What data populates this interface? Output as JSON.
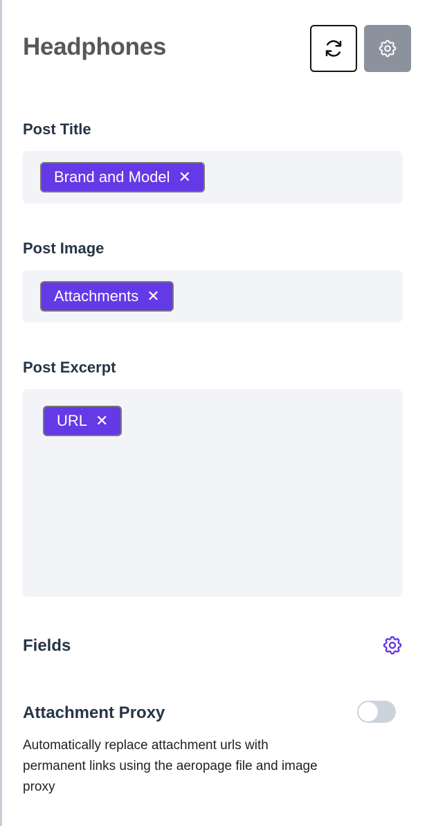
{
  "header": {
    "title": "Headphones",
    "refresh_icon": "refresh-icon",
    "settings_icon": "gear-icon"
  },
  "sections": [
    {
      "label": "Post Title",
      "chips": [
        "Brand and Model"
      ]
    },
    {
      "label": "Post Image",
      "chips": [
        "Attachments"
      ]
    },
    {
      "label": "Post Excerpt",
      "chips": [
        "URL"
      ]
    }
  ],
  "chip_remove": "✕",
  "fields": {
    "label": "Fields",
    "icon": "gear-icon"
  },
  "attachment_proxy": {
    "label": "Attachment Proxy",
    "enabled": false,
    "description": "Automatically replace attachment urls with permanent links using the aeropage file and image proxy"
  },
  "colors": {
    "accent": "#6439e6",
    "box": "#f3f4f8"
  }
}
